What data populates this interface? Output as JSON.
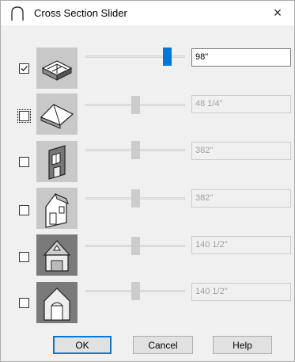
{
  "window": {
    "title": "Cross Section Slider",
    "close_glyph": "×"
  },
  "rows": [
    {
      "checked": true,
      "value": "98\"",
      "slider_fraction": 0.85,
      "enabled": true,
      "icon": "floor-plan-icon"
    },
    {
      "checked": false,
      "value": "48 1/4\"",
      "slider_fraction": 0.5,
      "enabled": false,
      "icon": "roof-icon"
    },
    {
      "checked": false,
      "value": "382\"",
      "slider_fraction": 0.5,
      "enabled": false,
      "icon": "wall-section-icon"
    },
    {
      "checked": false,
      "value": "382\"",
      "slider_fraction": 0.5,
      "enabled": false,
      "icon": "house-elevation-icon"
    },
    {
      "checked": false,
      "value": "140 1/2\"",
      "slider_fraction": 0.5,
      "enabled": false,
      "icon": "house-perspective-icon"
    },
    {
      "checked": false,
      "value": "140 1/2\"",
      "slider_fraction": 0.5,
      "enabled": false,
      "icon": "house-section-icon"
    }
  ],
  "buttons": {
    "ok": "OK",
    "cancel": "Cancel",
    "help": "Help"
  },
  "colors": {
    "accent": "#0078d7",
    "disabled_handle": "#cccccc",
    "thumb_bg": "#c8c8c8"
  }
}
